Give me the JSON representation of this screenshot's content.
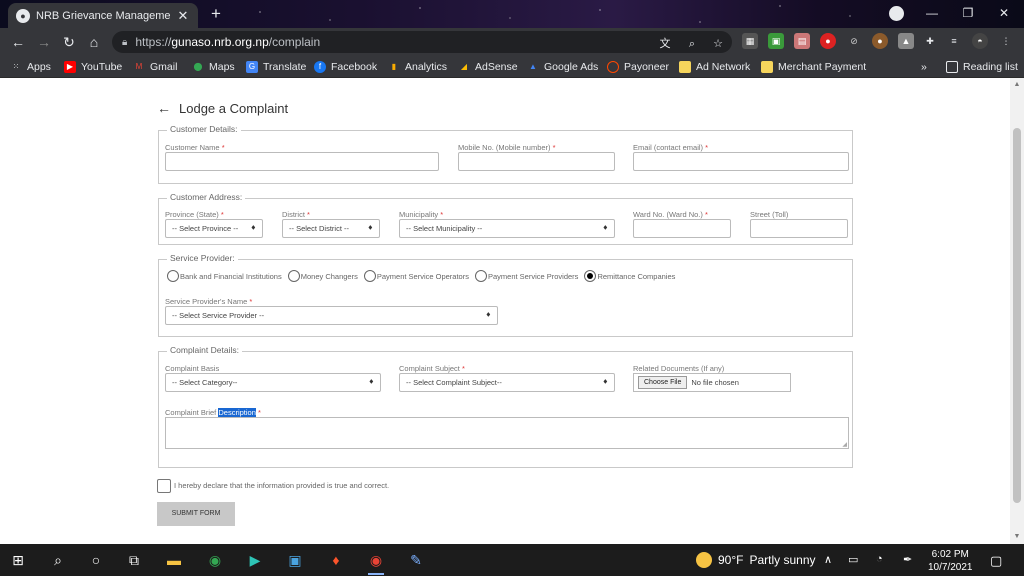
{
  "browser": {
    "tab_title": "NRB Grievance Management Sys",
    "url_scheme": "https://",
    "url_host": "gunaso.nrb.org.np",
    "url_path": "/complain"
  },
  "bookmarks": [
    {
      "label": "Apps",
      "icon": "apps-grid-icon",
      "color": "#e8eaed"
    },
    {
      "label": "YouTube",
      "icon": "youtube-icon",
      "color": "#ff0000"
    },
    {
      "label": "Gmail",
      "icon": "gmail-icon",
      "color": "#ea4335"
    },
    {
      "label": "Maps",
      "icon": "maps-icon",
      "color": "#34a853"
    },
    {
      "label": "Translate",
      "icon": "translate-icon",
      "color": "#4285f4"
    },
    {
      "label": "Facebook",
      "icon": "facebook-icon",
      "color": "#1877f2"
    },
    {
      "label": "Analytics",
      "icon": "analytics-icon",
      "color": "#f9ab00"
    },
    {
      "label": "AdSense",
      "icon": "adsense-icon",
      "color": "#fbbc04"
    },
    {
      "label": "Google Ads",
      "icon": "google-ads-icon",
      "color": "#4285f4"
    },
    {
      "label": "Payoneer",
      "icon": "payoneer-icon",
      "color": "#ff4800"
    },
    {
      "label": "Ad Network",
      "icon": "folder-icon",
      "color": "#f6d55c"
    },
    {
      "label": "Merchant Payment",
      "icon": "folder-icon",
      "color": "#f6d55c"
    }
  ],
  "reading_list": "Reading list",
  "page": {
    "heading": "Lodge a Complaint",
    "customer_details": {
      "legend": "Customer Details:",
      "name_label": "Customer Name",
      "mobile_label": "Mobile No. (Mobile number)",
      "email_label": "Email (contact email)"
    },
    "customer_address": {
      "legend": "Customer Address:",
      "province_label": "Province (State)",
      "province_value": "-- Select Province --",
      "district_label": "District",
      "district_value": "-- Select District --",
      "municipality_label": "Municipality",
      "municipality_value": "-- Select Municipality --",
      "ward_label": "Ward No. (Ward No.)",
      "street_label": "Street (Toll)"
    },
    "service_provider": {
      "legend": "Service Provider:",
      "options": [
        {
          "label": "Bank and Financial Institutions",
          "selected": false
        },
        {
          "label": "Money Changers",
          "selected": false
        },
        {
          "label": "Payment Service Operators",
          "selected": false
        },
        {
          "label": "Payment Service Providers",
          "selected": false
        },
        {
          "label": "Remittance Companies",
          "selected": true
        }
      ],
      "name_label": "Service Provider's Name",
      "name_value": "-- Select Service Provider --"
    },
    "complaint_details": {
      "legend": "Complaint Details:",
      "basis_label": "Complaint Basis",
      "basis_value": "-- Select Category--",
      "subject_label": "Complaint Subject",
      "subject_value": "-- Select Complaint Subject--",
      "docs_label": "Related Documents (If any)",
      "file_button": "Choose File",
      "file_status": "No file chosen",
      "brief_label_a": "Complaint Brief ",
      "brief_label_b": "Description"
    },
    "required_mark": "*",
    "declaration": "I hereby declare that the information provided is true and correct.",
    "submit": "SUBMIT FORM"
  },
  "taskbar": {
    "weather_temp": "90°F",
    "weather_text": "Partly sunny",
    "time": "6:02 PM",
    "date": "10/7/2021"
  }
}
